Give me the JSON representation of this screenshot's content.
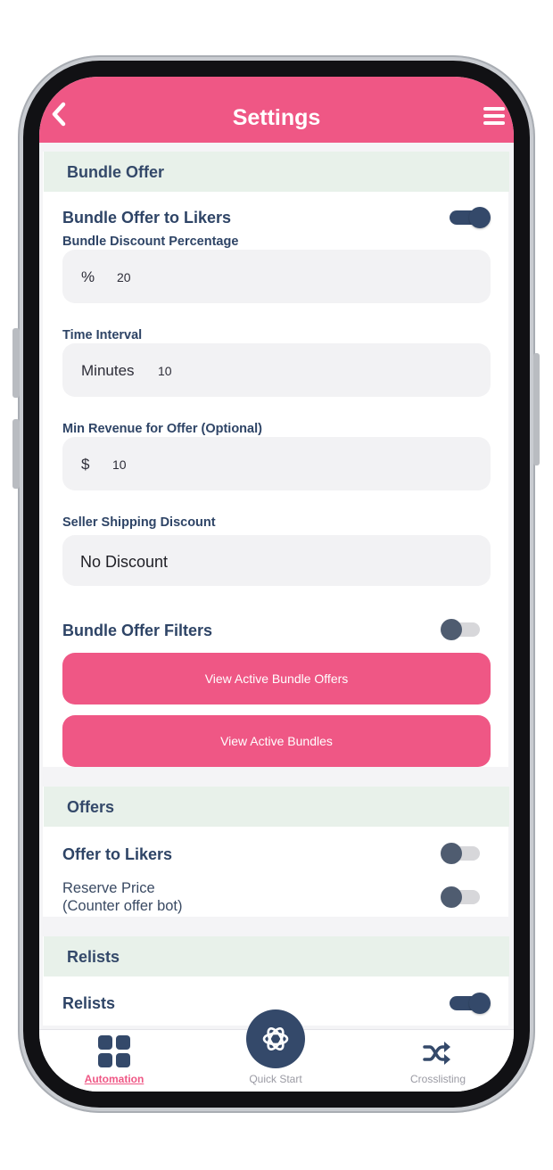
{
  "header": {
    "title": "Settings",
    "back_icon": "chevron-left-icon",
    "menu_icon": "hamburger-menu-icon",
    "color": "#ef5785"
  },
  "bundle_offer": {
    "section_title": "Bundle Offer",
    "to_likers_label": "Bundle Offer to Likers",
    "to_likers_enabled": true,
    "discount_label": "Bundle Discount Percentage",
    "discount_prefix": "%",
    "discount_value": "20",
    "interval_label": "Time Interval",
    "interval_prefix": "Minutes",
    "interval_value": "10",
    "min_revenue_label": "Min Revenue for Offer (Optional)",
    "min_revenue_prefix": "$",
    "min_revenue_value": "10",
    "shipping_label": "Seller Shipping Discount",
    "shipping_value": "No Discount",
    "filters_label": "Bundle Offer Filters",
    "filters_enabled": false,
    "view_offers_button": "View Active Bundle Offers",
    "view_bundles_button": "View Active Bundles"
  },
  "offers": {
    "section_title": "Offers",
    "to_likers_label": "Offer to Likers",
    "to_likers_enabled": false,
    "reserve_label_line1": "Reserve Price",
    "reserve_label_line2": "(Counter offer bot)",
    "reserve_enabled": false
  },
  "relists": {
    "section_title": "Relists",
    "relists_label": "Relists",
    "relists_enabled": true
  },
  "bottom_nav": {
    "automation_label": "Automation",
    "automation_icon": "grid-icon",
    "quick_start_label": "Quick Start",
    "quick_start_icon": "openai-knot-icon",
    "crosslisting_label": "Crosslisting",
    "crosslisting_icon": "shuffle-icon"
  },
  "colors": {
    "accent_pink": "#ef5785",
    "navy": "#34496a",
    "section_bg": "#e8f1ea"
  }
}
